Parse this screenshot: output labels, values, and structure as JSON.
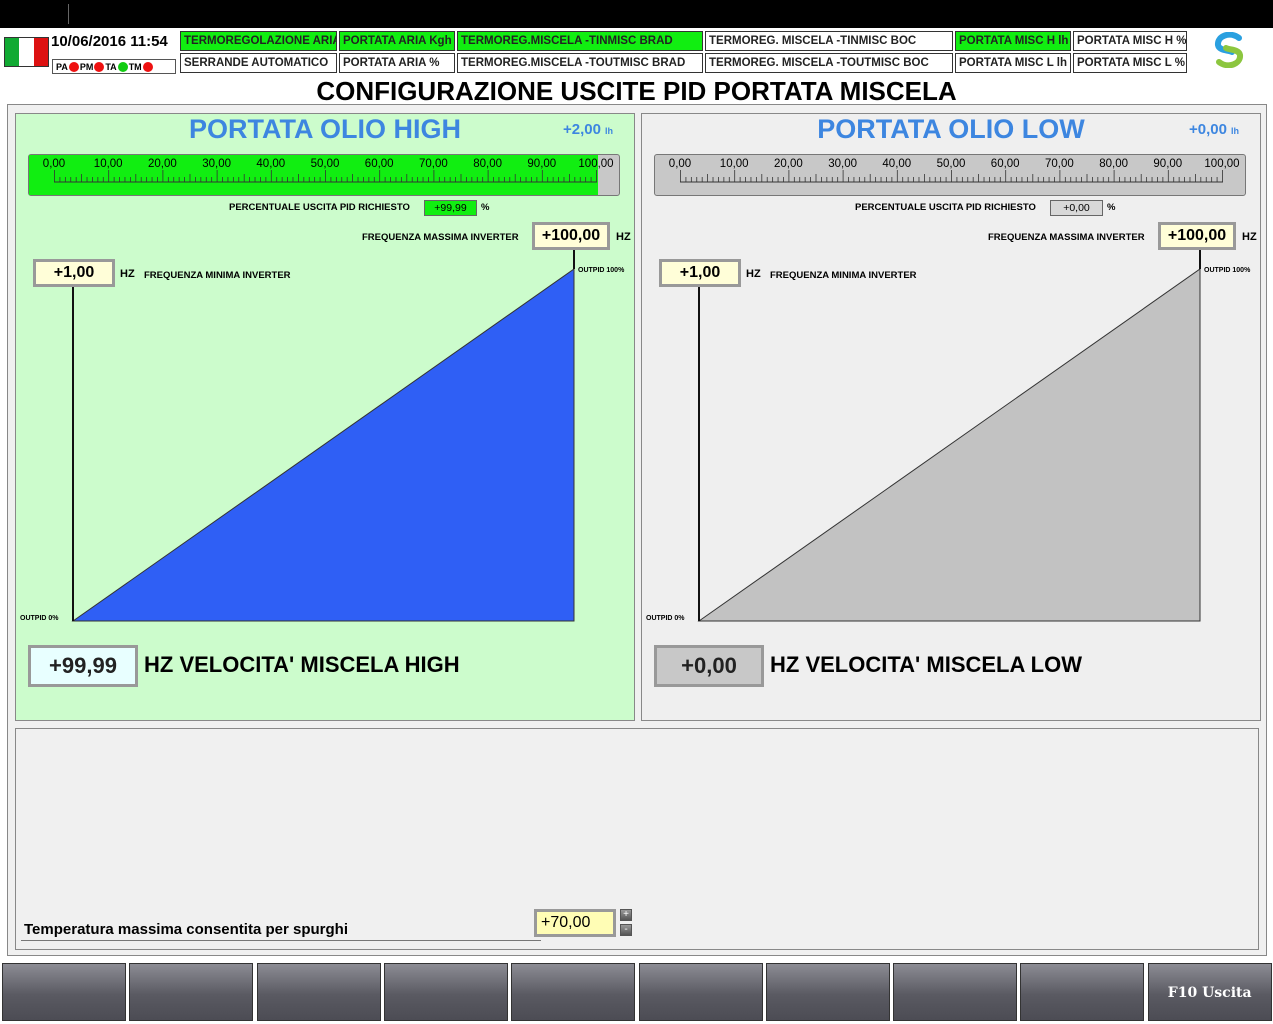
{
  "header": {
    "datetime": "10/06/2016 11:54",
    "indicators": [
      {
        "label": "PA",
        "color": "#ee1111"
      },
      {
        "label": "PM",
        "color": "#ee1111"
      },
      {
        "label": "TA",
        "color": "#11cc11"
      },
      {
        "label": "TM",
        "color": "#ee1111"
      }
    ],
    "nav_row1": [
      {
        "label": "TERMOREGOLAZIONE ARIA",
        "active": true
      },
      {
        "label": "PORTATA ARIA Kgh",
        "active": true
      },
      {
        "label": "TERMOREG.MISCELA -TINMISC BRAD",
        "active": true
      },
      {
        "label": "TERMOREG. MISCELA -TINMISC BOC",
        "active": false
      },
      {
        "label": "PORTATA MISC H lh",
        "active": true
      },
      {
        "label": "PORTATA MISC H %",
        "active": false
      }
    ],
    "nav_row2": [
      {
        "label": "SERRANDE AUTOMATICO",
        "active": false
      },
      {
        "label": "PORTATA ARIA %",
        "active": false
      },
      {
        "label": "TERMOREG.MISCELA -TOUTMISC BRAD",
        "active": false
      },
      {
        "label": "TERMOREG. MISCELA -TOUTMISC BOC",
        "active": false
      },
      {
        "label": "PORTATA MISC L lh",
        "active": false
      },
      {
        "label": "PORTATA MISC L %",
        "active": false
      }
    ]
  },
  "page_title": "CONFIGURAZIONE USCITE PID PORTATA MISCELA",
  "scale_labels": [
    "0,00",
    "10,00",
    "20,00",
    "30,00",
    "40,00",
    "50,00",
    "60,00",
    "70,00",
    "80,00",
    "90,00",
    "100,00"
  ],
  "panels": [
    {
      "id": "high",
      "title": "PORTATA OLIO HIGH",
      "flow_value": "+2,00",
      "flow_unit": "lh",
      "pid_label": "PERCENTUALE USCITA PID RICHIESTO",
      "pid_value": "+99,99",
      "pid_fraction": 0.9999,
      "pid_unit": "%",
      "max_freq_label": "FREQUENZA MASSIMA INVERTER",
      "max_freq": "+100,00",
      "min_freq_label": "FREQUENZA MINIMA INVERTER",
      "min_freq": "+1,00",
      "hz": "HZ",
      "outpid_100": "OUTPID 100%",
      "outpid_0": "OUTPID 0%",
      "speed_value": "+99,99",
      "speed_label": "HZ  VELOCITA' MISCELA HIGH",
      "colors": {
        "bg": "#ccfccc",
        "fill": "#2f5ff5",
        "bar": "#11ee11",
        "speed_bg": "#e8ffff"
      }
    },
    {
      "id": "low",
      "title": "PORTATA OLIO LOW",
      "flow_value": "+0,00",
      "flow_unit": "lh",
      "pid_label": "PERCENTUALE USCITA PID RICHIESTO",
      "pid_value": "+0,00",
      "pid_fraction": 0,
      "pid_unit": "%",
      "max_freq_label": "FREQUENZA MASSIMA INVERTER",
      "max_freq": "+100,00",
      "min_freq_label": "FREQUENZA MINIMA INVERTER",
      "min_freq": "+1,00",
      "hz": "HZ",
      "outpid_100": "OUTPID 100%",
      "outpid_0": "OUTPID 0%",
      "speed_value": "+0,00",
      "speed_label": "HZ  VELOCITA' MISCELA LOW",
      "colors": {
        "bg": "#efefef",
        "fill": "#c2c2c2",
        "bar": "#11ee11",
        "speed_bg": "#c8c8c8"
      }
    }
  ],
  "bottom": {
    "temp_label": "Temperatura massima consentita per spurghi",
    "temp_value": "+70,00",
    "spin_up": "+",
    "spin_down": "-"
  },
  "fkeys": [
    "",
    "",
    "",
    "",
    "",
    "",
    "",
    "",
    "",
    "F10 Uscita"
  ]
}
